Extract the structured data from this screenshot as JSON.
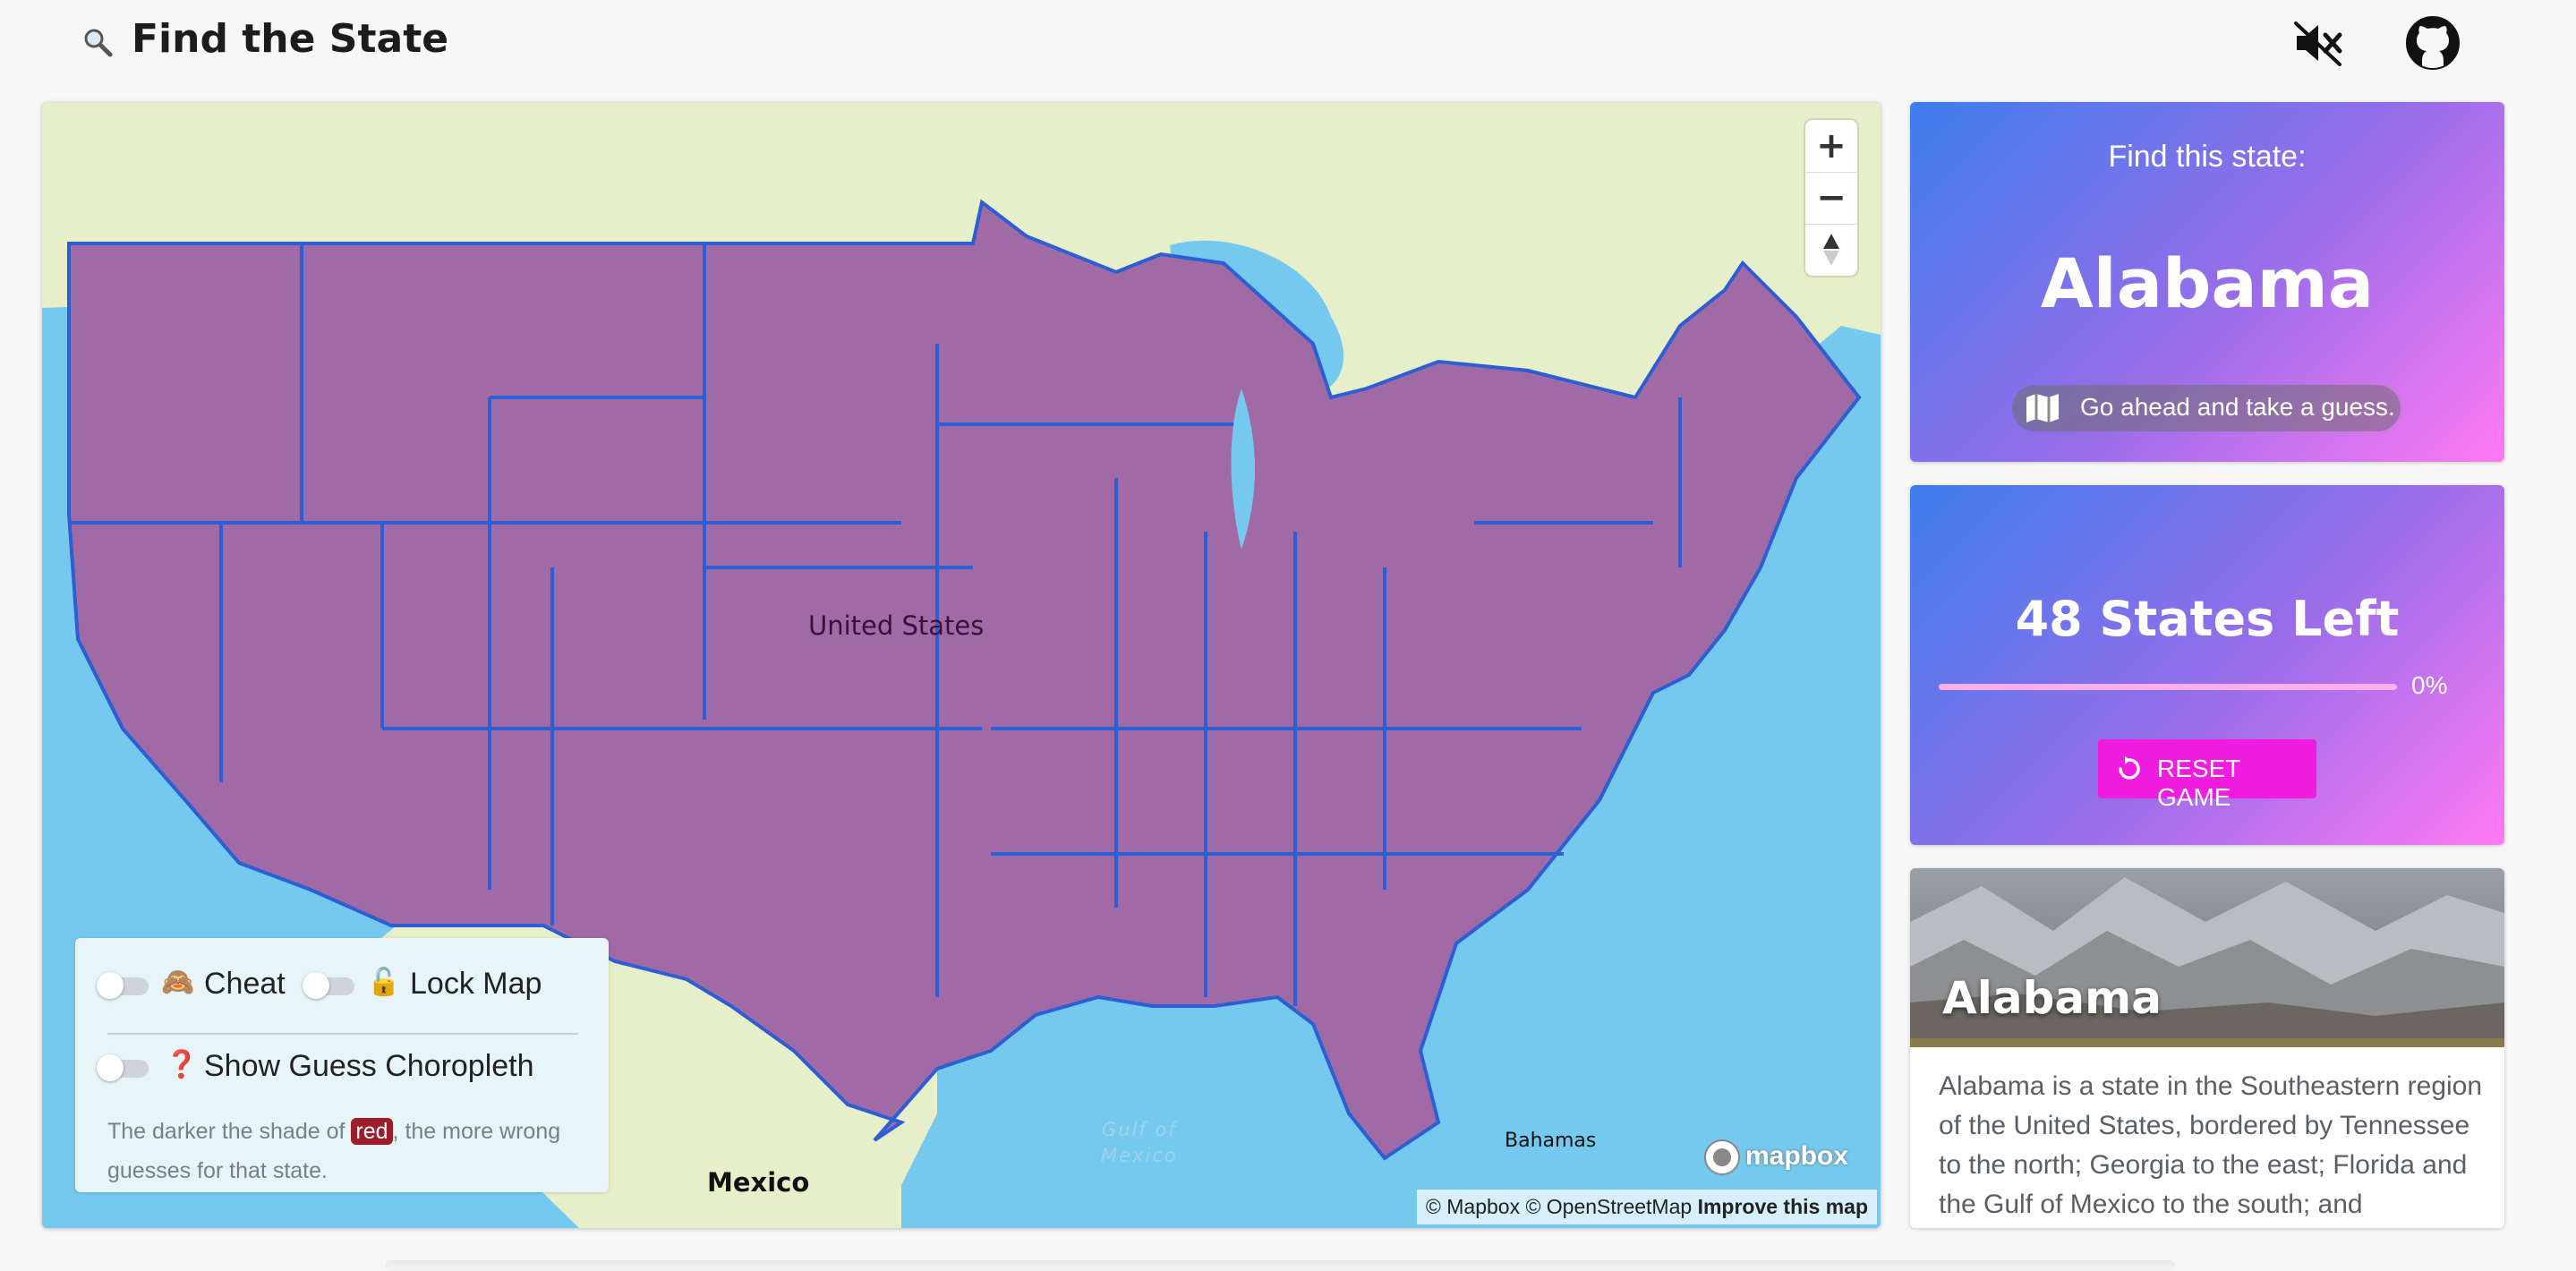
{
  "header": {
    "title": "Find the State",
    "title_icon": "magnifier-icon",
    "mute_icon": "speaker-muted-icon",
    "github_icon": "github-icon"
  },
  "map": {
    "labels": {
      "country": "United States",
      "mexico": "Mexico",
      "bahamas": "Bahamas",
      "gulf_line1": "Gulf of",
      "gulf_line2": "Mexico"
    },
    "zoom_in": "+",
    "zoom_out": "−",
    "compass": "▲",
    "logo_text": "mapbox",
    "attribution": "© Mapbox © OpenStreetMap",
    "improve_link": "Improve this map",
    "colors": {
      "water": "#75c9ee",
      "land": "#e6efc9",
      "states": "#a06aa6",
      "state_border": "#2c5fd4"
    }
  },
  "controls": {
    "cheat_label": "Cheat",
    "cheat_emoji": "🙈",
    "lock_label": "Lock Map",
    "lock_emoji": "🔓",
    "choropleth_label": "Show Guess Choropleth",
    "choropleth_emoji": "❓",
    "help_before": "The darker the shade of",
    "help_red": "red",
    "help_after": ", the more wrong guesses for that state.",
    "cheat_on": false,
    "lock_on": false,
    "choropleth_on": false
  },
  "target": {
    "prompt": "Find this state:",
    "state_name": "Alabama",
    "hint": "Go ahead and take a guess.",
    "hint_icon": "map-icon"
  },
  "progress": {
    "states_left": "48 States Left",
    "percent": 0,
    "percent_label": "0%",
    "reset_label": "RESET GAME",
    "reset_icon": "reset-icon"
  },
  "info": {
    "title": "Alabama",
    "description": "Alabama is a state in the Southeastern region of the United States, bordered by Tennessee to the north; Georgia to the east; Florida and the Gulf of Mexico to the south; and"
  }
}
